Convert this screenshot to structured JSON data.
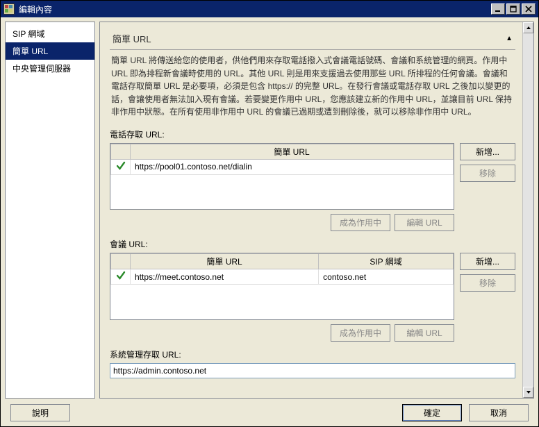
{
  "window": {
    "title": "編輯內容",
    "minimize": "minimize",
    "maximize": "maximize",
    "close": "close"
  },
  "sidebar": {
    "items": [
      {
        "label": "SIP 網域",
        "selected": false
      },
      {
        "label": "簡單 URL",
        "selected": true
      },
      {
        "label": "中央管理伺服器",
        "selected": false
      }
    ]
  },
  "section": {
    "title": "簡單 URL",
    "description": "簡單 URL 將傳送給您的使用者，供他們用來存取電話撥入式會議電話號碼、會議和系統管理的網頁。作用中 URL 即為排程新會議時使用的 URL。其他 URL 則是用來支援過去使用那些 URL 所排程的任何會議。會議和電話存取簡單 URL 是必要項，必須是包含 https:// 的完整 URL。在發行會議或電話存取 URL 之後加以變更的話，會讓使用者無法加入現有會議。若要變更作用中 URL，您應該建立新的作用中 URL，並讓目前 URL 保持非作用中狀態。在所有使用非作用中 URL 的會議已過期或遭到刪除後，就可以移除非作用中 URL。"
  },
  "dialin": {
    "label": "電話存取 URL:",
    "header": "簡單 URL",
    "rows": [
      {
        "active": true,
        "url": "https://pool01.contoso.net/dialin"
      }
    ]
  },
  "meet": {
    "label": "會議 URL:",
    "header_url": "簡單 URL",
    "header_domain": "SIP 網域",
    "rows": [
      {
        "active": true,
        "url": "https://meet.contoso.net",
        "domain": "contoso.net"
      }
    ]
  },
  "admin": {
    "label": "系統管理存取 URL:",
    "value": "https://admin.contoso.net"
  },
  "buttons": {
    "add": "新增...",
    "remove": "移除",
    "make_active": "成為作用中",
    "edit_url": "編輯 URL",
    "help": "說明",
    "ok": "確定",
    "cancel": "取消"
  }
}
